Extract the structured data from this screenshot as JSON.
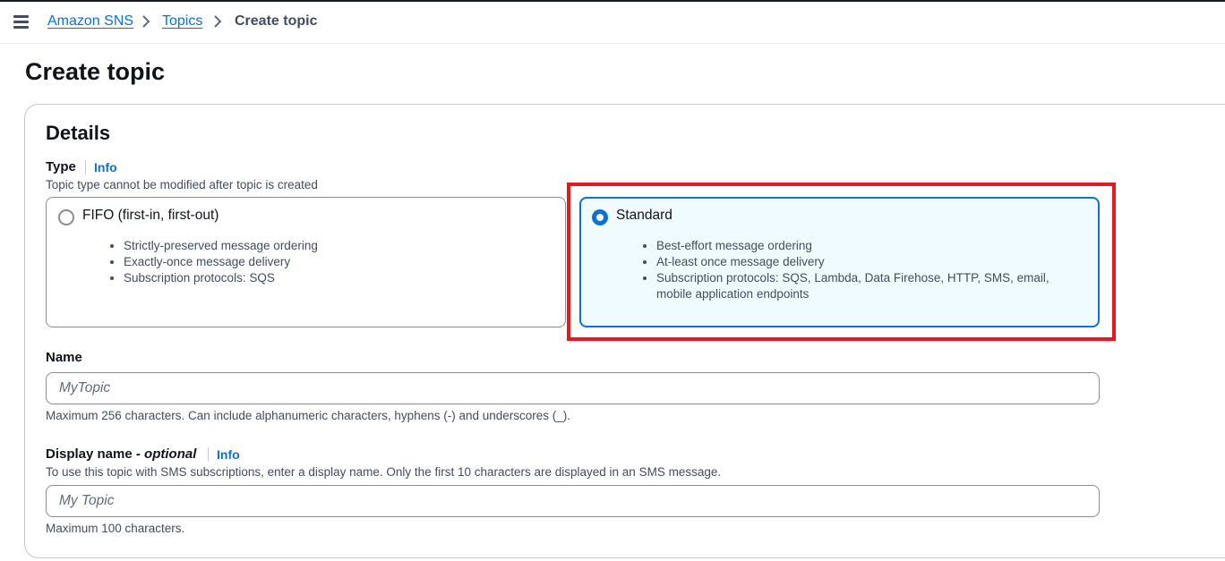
{
  "breadcrumb": {
    "items": [
      {
        "label": "Amazon SNS"
      },
      {
        "label": "Topics"
      }
    ],
    "current": "Create topic"
  },
  "page": {
    "title": "Create topic"
  },
  "details": {
    "title": "Details",
    "type": {
      "label": "Type",
      "info": "Info",
      "description": "Topic type cannot be modified after topic is created",
      "options": [
        {
          "title": "FIFO (first-in, first-out)",
          "selected": false,
          "bullets": [
            "Strictly-preserved message ordering",
            "Exactly-once message delivery",
            "Subscription protocols: SQS"
          ]
        },
        {
          "title": "Standard",
          "selected": true,
          "bullets": [
            "Best-effort message ordering",
            "At-least once message delivery",
            "Subscription protocols: SQS, Lambda, Data Firehose, HTTP, SMS, email, mobile application endpoints"
          ]
        }
      ]
    },
    "name": {
      "label": "Name",
      "placeholder": "MyTopic",
      "constraint": "Maximum 256 characters. Can include alphanumeric characters, hyphens (-) and underscores (_)."
    },
    "display_name": {
      "label": "Display name - ",
      "label_optional": "optional",
      "info": "Info",
      "description": "To use this topic with SMS subscriptions, enter a display name. Only the first 10 characters are displayed in an SMS message.",
      "placeholder": "My Topic",
      "constraint": "Maximum 100 characters."
    }
  },
  "colors": {
    "link": "#0972d3",
    "selected_tile_bg": "#f0fbff",
    "highlight": "#e3191c"
  }
}
